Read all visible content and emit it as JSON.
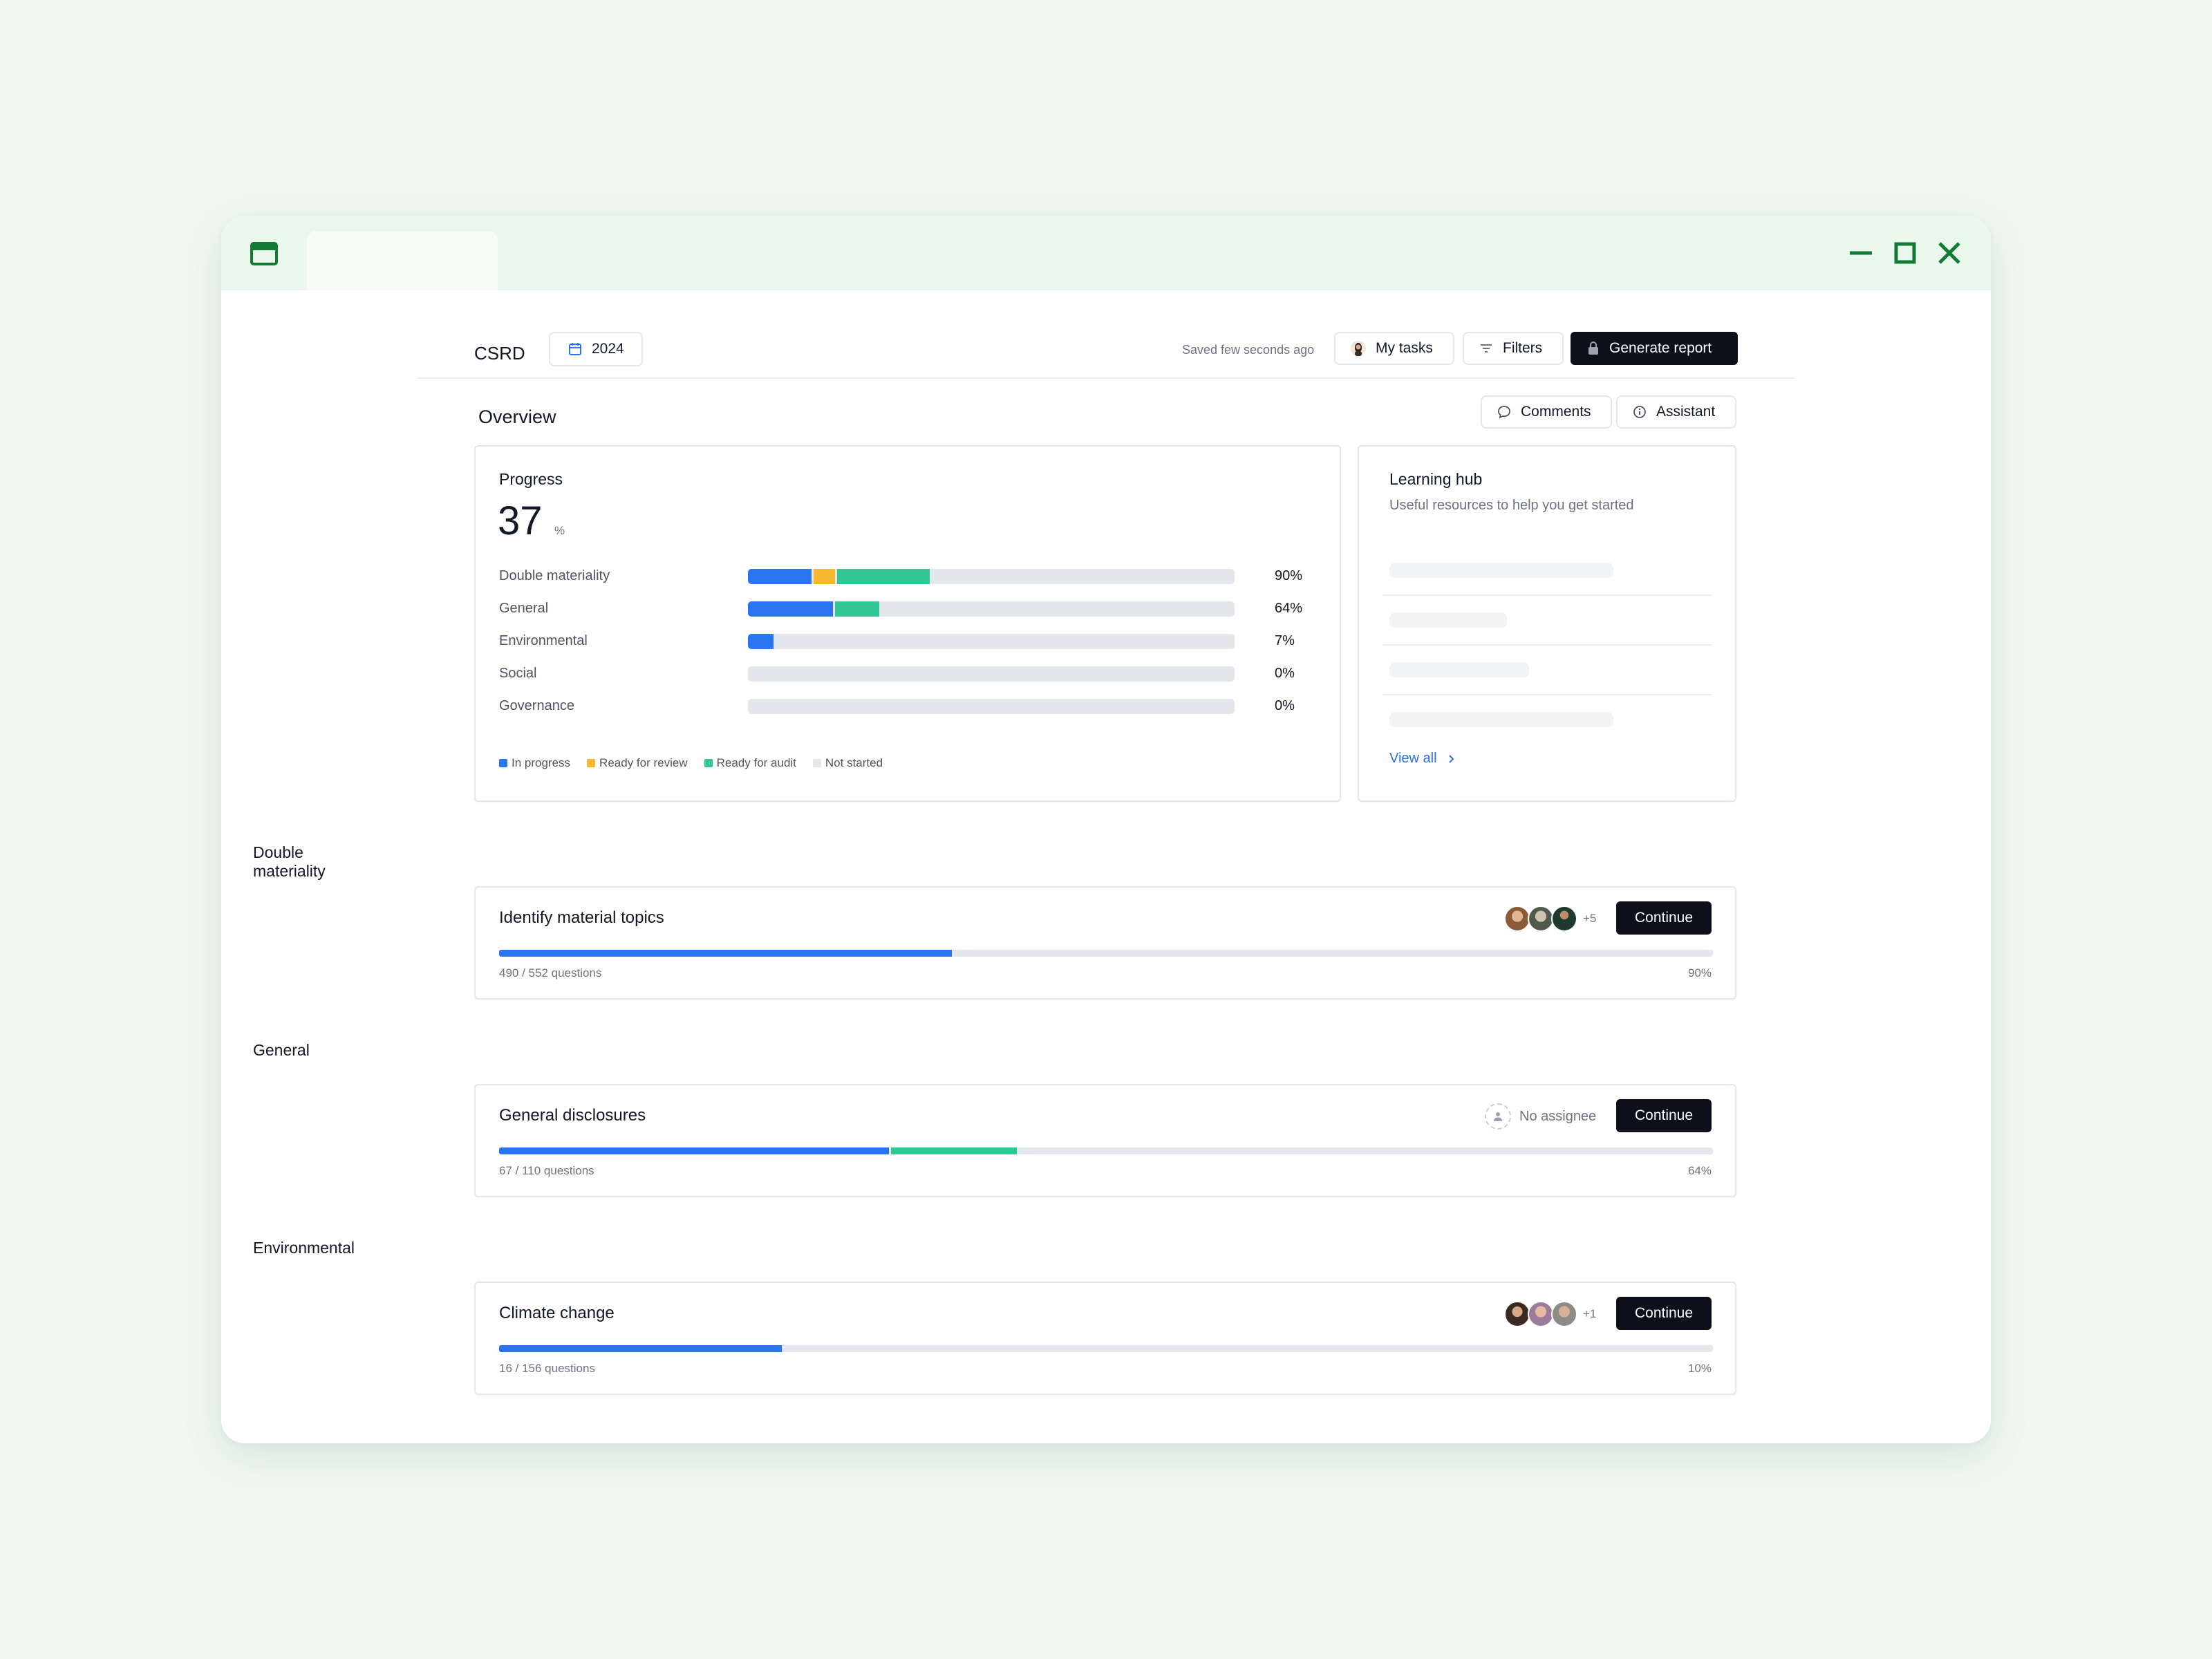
{
  "header": {
    "title": "CSRD",
    "year": "2024",
    "saved": "Saved few seconds ago",
    "my_tasks": "My tasks",
    "filters": "Filters",
    "generate_report": "Generate report"
  },
  "overview": {
    "title": "Overview",
    "comments": "Comments",
    "assistant": "Assistant"
  },
  "progress": {
    "label": "Progress",
    "value": "37",
    "unit": "%",
    "rows": [
      {
        "label": "Double materiality",
        "pct": "90%",
        "in_progress": 0.13,
        "ready_review": 0.045,
        "ready_audit": 0.19
      },
      {
        "label": "General",
        "pct": "64%",
        "in_progress": 0.175,
        "ready_review": 0,
        "ready_audit": 0.09
      },
      {
        "label": "Environmental",
        "pct": "7%",
        "in_progress": 0.052,
        "ready_review": 0,
        "ready_audit": 0
      },
      {
        "label": "Social",
        "pct": "0%",
        "in_progress": 0,
        "ready_review": 0,
        "ready_audit": 0
      },
      {
        "label": "Governance",
        "pct": "0%",
        "in_progress": 0,
        "ready_review": 0,
        "ready_audit": 0
      }
    ],
    "legend": {
      "in_progress": "In progress",
      "ready_review": "Ready for review",
      "ready_audit": "Ready for audit",
      "not_started": "Not started"
    }
  },
  "learning_hub": {
    "title": "Learning hub",
    "subtitle": "Useful resources to help you get started",
    "view_all": "View all"
  },
  "sections": [
    {
      "title": "Double materiality",
      "task": "Identify material topics",
      "count": "490 / 552 questions",
      "pct": "90%",
      "in_progress": 0.373,
      "ready_audit": 0,
      "extra": "+5",
      "continue": "Continue"
    },
    {
      "title": "General",
      "task": "General disclosures",
      "count": "67 / 110 questions",
      "pct": "64%",
      "in_progress": 0.321,
      "ready_audit": 0.104,
      "no_assignee": "No assignee",
      "continue": "Continue"
    },
    {
      "title": "Environmental",
      "task": "Climate change",
      "count": "16 / 156 questions",
      "pct": "10%",
      "in_progress": 0.233,
      "ready_audit": 0,
      "extra": "+1",
      "continue": "Continue"
    }
  ],
  "colors": {
    "in_progress": "#2a74f0",
    "ready_review": "#f5b82e",
    "ready_audit": "#34c796",
    "not_started": "#e5e7ef",
    "accent_green": "#137a35"
  },
  "icons": [
    "window-icon",
    "minimize-icon",
    "maximize-icon",
    "close-icon",
    "calendar-icon",
    "filter-icon",
    "lock-icon",
    "comment-icon",
    "info-icon",
    "chevron-right-icon",
    "user-icon"
  ]
}
